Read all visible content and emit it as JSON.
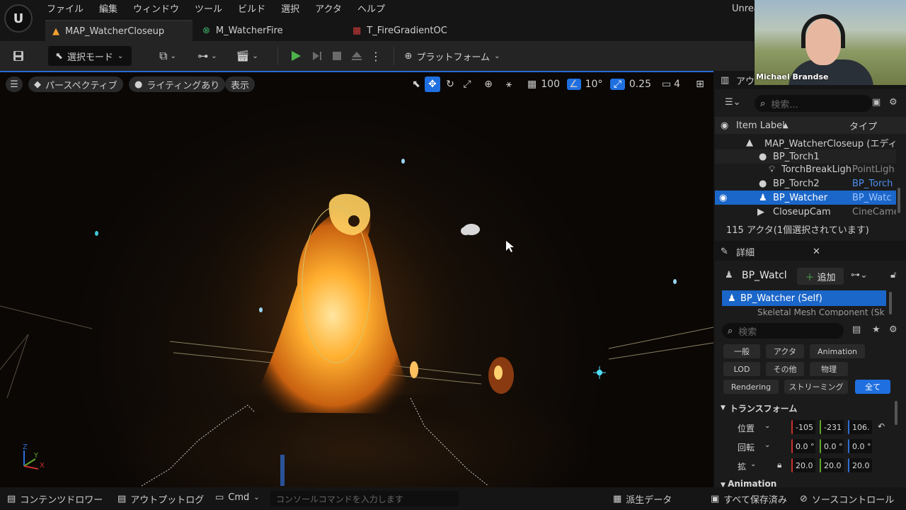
{
  "menubar": {
    "items": [
      "ファイル",
      "編集",
      "ウィンドウ",
      "ツール",
      "ビルド",
      "選択",
      "アクタ",
      "ヘルプ"
    ],
    "app_title": "Unrea"
  },
  "tabs": [
    {
      "label": "MAP_WatcherCloseup",
      "icon": "level-icon"
    },
    {
      "label": "M_WatcherFire",
      "icon": "material-icon"
    },
    {
      "label": "T_FireGradientOC",
      "icon": "texture-icon"
    }
  ],
  "toolbar": {
    "mode_label": "選択モード",
    "platform_label": "プラットフォーム"
  },
  "viewport": {
    "perspective_label": "パースペクティブ",
    "lighting_label": "ライティングあり",
    "show_label": "表示",
    "grid_snap": "100",
    "rotation_snap": "10°",
    "scale_snap": "0.25",
    "camera_speed": "4",
    "axis_labels": {
      "z": "Z",
      "y": "Y",
      "x": "X"
    }
  },
  "outliner": {
    "title": "アウ",
    "search_placeholder": "検索...",
    "col_label": "Item Label",
    "col_type": "タイプ",
    "rows": [
      {
        "name": "MAP_WatcherCloseup (エディタ",
        "type": ""
      },
      {
        "name": "BP_Torch1",
        "type": ""
      },
      {
        "name": "TorchBreakLigh",
        "type": "PointLigh"
      },
      {
        "name": "BP_Torch2",
        "type": "BP_Torch"
      },
      {
        "name": "BP_Watcher",
        "type": "BP_Watc"
      },
      {
        "name": "CloseupCam",
        "type": "CineCame"
      }
    ],
    "count_text": "115 アクタ(1個選択されています)"
  },
  "details": {
    "title": "詳細",
    "actor_name": "BP_Watcl",
    "add_label": "追加",
    "selected_component": "BP_Watcher (Self)",
    "next_component": "Skeletal Mesh Component (Sk",
    "search_placeholder": "検索",
    "filters": [
      "一般",
      "アクタ",
      "Animation",
      "LOD",
      "その他",
      "物理",
      "Rendering",
      "ストリーミング",
      "全て"
    ],
    "section": "トランスフォーム",
    "transform": {
      "location_label": "位置",
      "rotation_label": "回転",
      "scale_label": "拡",
      "location": [
        "-105",
        "-231",
        "106."
      ],
      "rotation": [
        "0.0 °",
        "0.0 °",
        "0.0 °"
      ],
      "scale": [
        "20.0",
        "20.0",
        "20.0"
      ]
    },
    "more_section": "Animation"
  },
  "statusbar": {
    "content_drawer": "コンテンツドロワー",
    "output_log": "アウトプットログ",
    "cmd": "Cmd",
    "console_placeholder": "コンソールコマンドを入力します",
    "derived_data": "派生データ",
    "save_all": "すべて保存済み",
    "source_control": "ソースコントロール"
  },
  "webcam": {
    "name": "Michael Brandse"
  },
  "colors": {
    "accent": "#1f6fe0",
    "selection": "#1b66c9",
    "play_green": "#4cb34a",
    "fire": "#ffb030"
  }
}
